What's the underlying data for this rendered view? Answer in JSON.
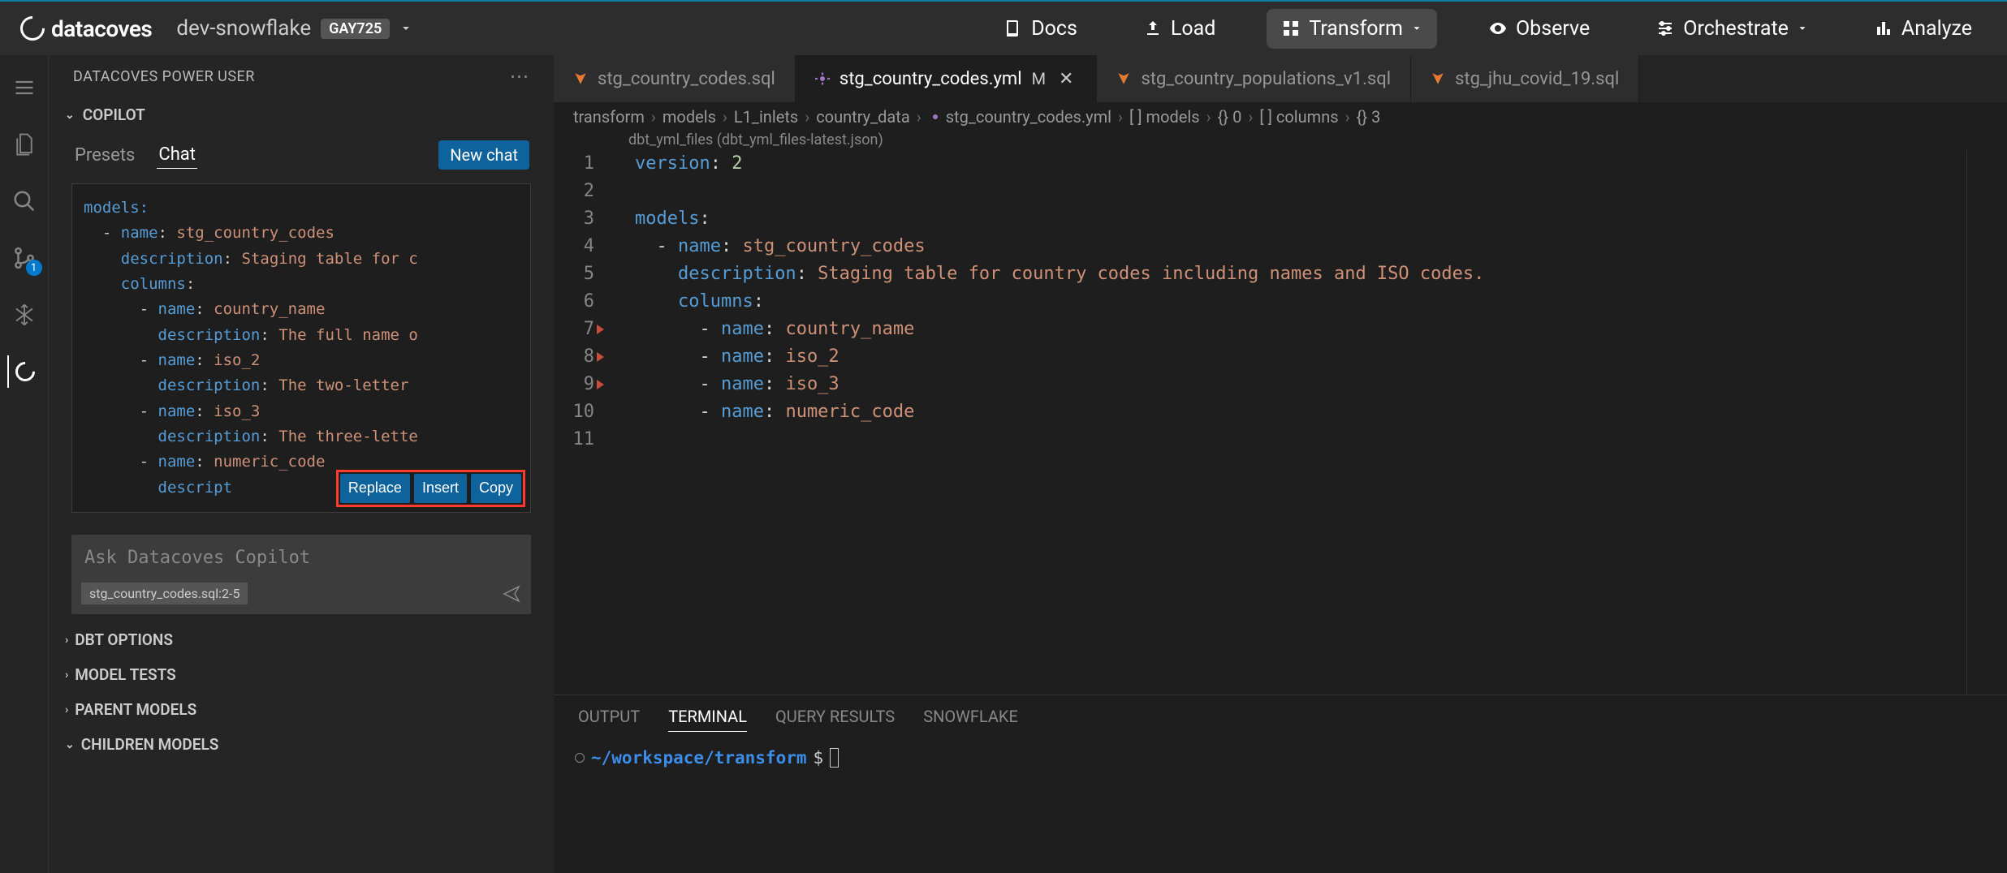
{
  "header": {
    "logo_text": "datacoves",
    "env_name": "dev-snowflake",
    "env_badge": "GAY725",
    "nav": [
      {
        "label": "Docs",
        "icon": "book-icon",
        "active": false
      },
      {
        "label": "Load",
        "icon": "upload-icon",
        "active": false
      },
      {
        "label": "Transform",
        "icon": "grid-icon",
        "active": true,
        "dropdown": true
      },
      {
        "label": "Observe",
        "icon": "eye-icon",
        "active": false
      },
      {
        "label": "Orchestrate",
        "icon": "sliders-icon",
        "active": false,
        "dropdown": true
      },
      {
        "label": "Analyze",
        "icon": "chart-icon",
        "active": false
      }
    ]
  },
  "activity_bar": {
    "scm_badge": "1"
  },
  "sidebar": {
    "title": "DATACOVES POWER USER",
    "copilot_label": "COPILOT",
    "tabs": {
      "presets": "Presets",
      "chat": "Chat"
    },
    "new_chat_label": "New chat",
    "code": {
      "l1": "models:",
      "l2": "  - name: stg_country_codes",
      "l3": "    description: Staging table for c",
      "l4": "    columns:",
      "l5": "      - name: country_name",
      "l6": "        description: The full name o",
      "l7": "      - name: iso_2",
      "l8": "        description: The two-letter",
      "l9": "      - name: iso_3",
      "l10": "        description: The three-lette",
      "l11": "      - name: numeric_code",
      "l12": "        descript                          o"
    },
    "actions": {
      "replace": "Replace",
      "insert": "Insert",
      "copy": "Copy"
    },
    "input_placeholder": "Ask Datacoves Copilot",
    "chip": "stg_country_codes.sql:2-5",
    "accordions": {
      "dbt_options": "DBT OPTIONS",
      "model_tests": "MODEL TESTS",
      "parent_models": "PARENT MODELS",
      "children_models": "CHILDREN MODELS"
    }
  },
  "editor": {
    "tabs": [
      {
        "name": "stg_country_codes.sql",
        "icon": "orange",
        "active": false
      },
      {
        "name": "stg_country_codes.yml",
        "icon": "purple",
        "active": true,
        "modified": "M"
      },
      {
        "name": "stg_country_populations_v1.sql",
        "icon": "orange",
        "active": false
      },
      {
        "name": "stg_jhu_covid_19.sql",
        "icon": "orange",
        "active": false
      }
    ],
    "breadcrumb": [
      "transform",
      "models",
      "L1_inlets",
      "country_data",
      "stg_country_codes.yml",
      "[ ] models",
      "{} 0",
      "[ ] columns",
      "{} 3"
    ],
    "codelens": "dbt_yml_files (dbt_yml_files-latest.json)",
    "lines": [
      {
        "n": "1",
        "tokens": [
          {
            "t": "version",
            "c": "key"
          },
          {
            "t": ":",
            "c": "punc"
          },
          {
            "t": " 2",
            "c": "num"
          }
        ]
      },
      {
        "n": "2",
        "tokens": []
      },
      {
        "n": "3",
        "tokens": [
          {
            "t": "models",
            "c": "key"
          },
          {
            "t": ":",
            "c": "punc"
          }
        ]
      },
      {
        "n": "4",
        "tokens": [
          {
            "t": "  - ",
            "c": "dash"
          },
          {
            "t": "name",
            "c": "key"
          },
          {
            "t": ":",
            "c": "punc"
          },
          {
            "t": " stg_country_codes",
            "c": "str"
          }
        ]
      },
      {
        "n": "5",
        "tokens": [
          {
            "t": "    ",
            "c": "dash"
          },
          {
            "t": "description",
            "c": "key"
          },
          {
            "t": ":",
            "c": "punc"
          },
          {
            "t": " Staging table for country codes including names and ISO codes.",
            "c": "str"
          }
        ]
      },
      {
        "n": "6",
        "tokens": [
          {
            "t": "    ",
            "c": "dash"
          },
          {
            "t": "columns",
            "c": "key"
          },
          {
            "t": ":",
            "c": "punc"
          }
        ]
      },
      {
        "n": "7",
        "tokens": [
          {
            "t": "      - ",
            "c": "dash"
          },
          {
            "t": "name",
            "c": "key"
          },
          {
            "t": ":",
            "c": "punc"
          },
          {
            "t": " country_name",
            "c": "str"
          }
        ],
        "fold": true
      },
      {
        "n": "8",
        "tokens": [
          {
            "t": "      - ",
            "c": "dash"
          },
          {
            "t": "name",
            "c": "key"
          },
          {
            "t": ":",
            "c": "punc"
          },
          {
            "t": " iso_2",
            "c": "str"
          }
        ],
        "fold": true
      },
      {
        "n": "9",
        "tokens": [
          {
            "t": "      - ",
            "c": "dash"
          },
          {
            "t": "name",
            "c": "key"
          },
          {
            "t": ":",
            "c": "punc"
          },
          {
            "t": " iso_3",
            "c": "str"
          }
        ],
        "fold": true
      },
      {
        "n": "10",
        "tokens": [
          {
            "t": "      - ",
            "c": "dash"
          },
          {
            "t": "name",
            "c": "key"
          },
          {
            "t": ":",
            "c": "punc"
          },
          {
            "t": " numeric_code",
            "c": "str"
          }
        ]
      },
      {
        "n": "11",
        "tokens": []
      }
    ]
  },
  "terminal": {
    "tabs": {
      "output": "OUTPUT",
      "terminal": "TERMINAL",
      "query_results": "QUERY RESULTS",
      "snowflake": "SNOWFLAKE"
    },
    "prompt_path": "~/workspace/transform",
    "prompt_symbol": "$"
  }
}
